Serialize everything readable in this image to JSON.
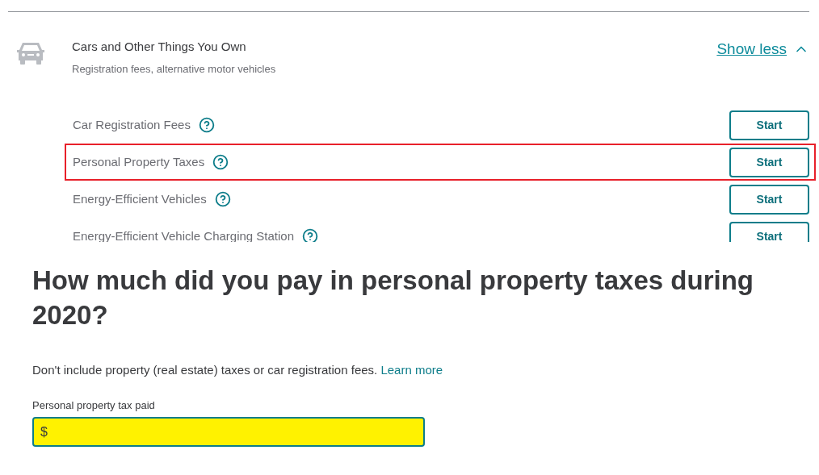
{
  "section": {
    "title": "Cars and Other Things You Own",
    "subtitle": "Registration fees, alternative motor vehicles",
    "toggle": "Show less",
    "expanded": true,
    "items": [
      {
        "label": "Car Registration Fees",
        "button": "Start",
        "highlighted": false
      },
      {
        "label": "Personal Property Taxes",
        "button": "Start",
        "highlighted": true
      },
      {
        "label": "Energy-Efficient Vehicles",
        "button": "Start",
        "highlighted": false
      },
      {
        "label": "Energy-Efficient Vehicle Charging Station",
        "button": "Start",
        "highlighted": false
      }
    ]
  },
  "question": {
    "heading": "How much did you pay in personal property taxes during 2020?",
    "note": "Don't include property (real estate) taxes or car registration fees.",
    "link": "Learn more",
    "field": {
      "label": "Personal property tax paid",
      "value": "$"
    }
  }
}
